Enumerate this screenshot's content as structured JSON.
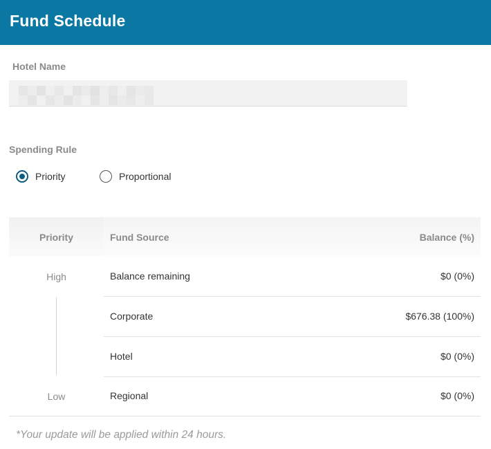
{
  "header": {
    "title": "Fund Schedule"
  },
  "hotel": {
    "label": "Hotel Name",
    "value": ""
  },
  "spending_rule": {
    "label": "Spending Rule",
    "options": [
      {
        "label": "Priority",
        "selected": true
      },
      {
        "label": "Proportional",
        "selected": false
      }
    ]
  },
  "table": {
    "headers": {
      "priority": "Priority",
      "fund_source": "Fund Source",
      "balance": "Balance (%)"
    },
    "priority_high": "High",
    "priority_low": "Low",
    "rows": [
      {
        "source": "Balance remaining",
        "balance": "$0 (0%)"
      },
      {
        "source": "Corporate",
        "balance": "$676.38 (100%)"
      },
      {
        "source": "Hotel",
        "balance": "$0 (0%)"
      },
      {
        "source": "Regional",
        "balance": "$0 (0%)"
      }
    ]
  },
  "note": "*Your update will be applied within 24 hours.",
  "colors": {
    "header_bg": "#0a78a3",
    "radio_accent": "#0b5c80"
  }
}
